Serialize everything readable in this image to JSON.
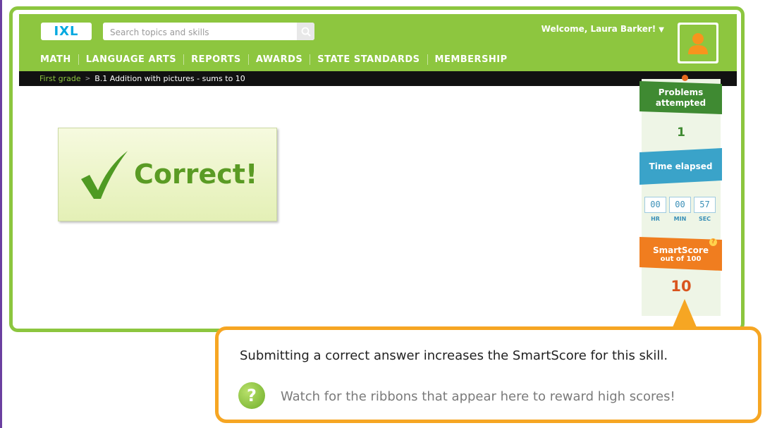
{
  "header": {
    "logo_text": "IXL",
    "search_placeholder": "Search topics and skills",
    "welcome": "Welcome, Laura Barker!",
    "nav": [
      "MATH",
      "LANGUAGE ARTS",
      "REPORTS",
      "AWARDS",
      "STATE STANDARDS",
      "MEMBERSHIP"
    ]
  },
  "breadcrumb": {
    "grade": "First grade",
    "separator": ">",
    "skill": "B.1 Addition with pictures - sums to 10"
  },
  "feedback": {
    "message": "Correct!"
  },
  "sidebar": {
    "problems_label_1": "Problems",
    "problems_label_2": "attempted",
    "problems_count": "1",
    "time_label": "Time elapsed",
    "hr": "00",
    "min": "00",
    "sec": "57",
    "hr_label": "HR",
    "min_label": "MIN",
    "sec_label": "SEC",
    "smartscore_label": "SmartScore",
    "smartscore_sub": "out of 100",
    "smartscore_value": "10"
  },
  "callout": {
    "line1": "Submitting a correct answer increases the SmartScore for this skill.",
    "line2": "Watch for the ribbons that appear here to reward high scores!",
    "help_glyph": "?"
  },
  "colors": {
    "brand_green": "#8dc63f",
    "callout_orange": "#f6a623",
    "smartscore_orange": "#f07d1f",
    "time_blue": "#3aa3c9"
  },
  "icons": [
    "search-icon",
    "caret-down-icon",
    "user-avatar-icon",
    "checkmark-icon",
    "help-icon"
  ]
}
